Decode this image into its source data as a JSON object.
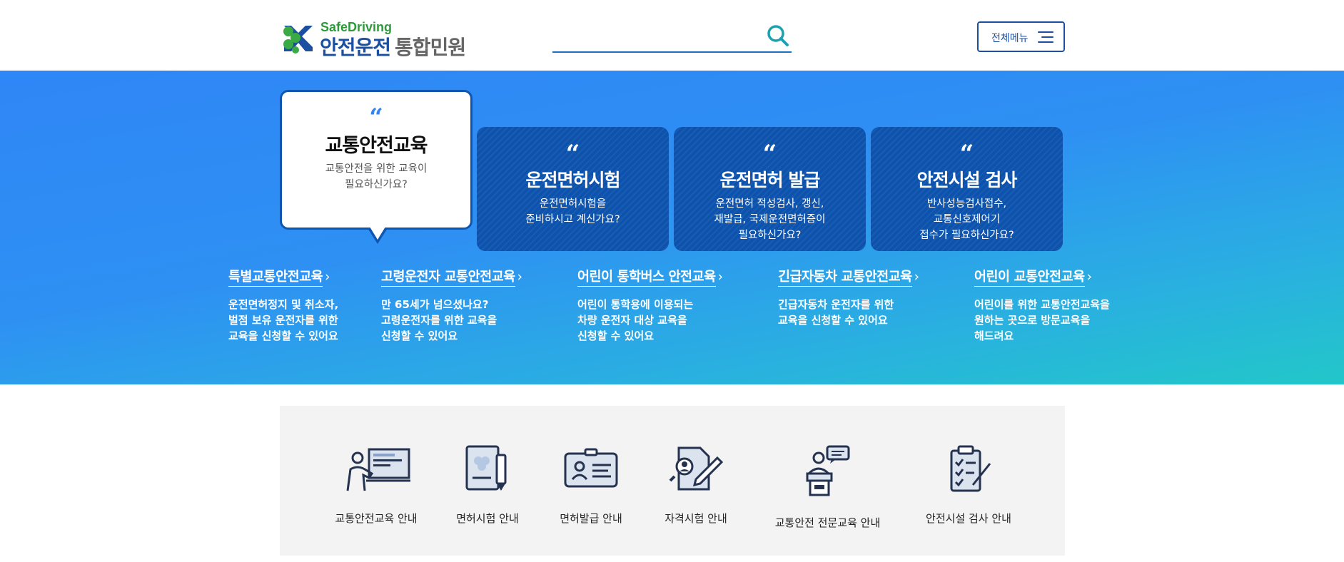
{
  "header": {
    "logo_sub": "SafeDriving",
    "logo_main": "안전운전",
    "logo_service": "통합민원",
    "search_placeholder": "",
    "menu_label": "전체메뉴"
  },
  "cards": [
    {
      "title": "교통안전교육",
      "desc": "교통안전을 위한 교육이\n필요하신가요?"
    },
    {
      "title": "운전면허시험",
      "desc": "운전면허시험을\n준비하시고 계신가요?"
    },
    {
      "title": "운전면허 발급",
      "desc": "운전면허 적성검사, 갱신,\n재발급, 국제운전면허증이\n필요하신가요?"
    },
    {
      "title": "안전시설 검사",
      "desc": "반사성능검사접수,\n교통신호제어기\n접수가 필요하신가요?"
    }
  ],
  "sub_links": [
    {
      "label": "특별교통안전교육",
      "desc": "운전면허정지 및 취소자,\n벌점 보유 운전자를 위한\n교육을 신청할 수 있어요"
    },
    {
      "label": "고령운전자 교통안전교육",
      "desc": "만 65세가 넘으셨나요?\n고령운전자를 위한 교육을\n신청할 수 있어요"
    },
    {
      "label": "어린이 통학버스 안전교육",
      "desc": "어린이 통학용에 이용되는\n차량 운전자 대상 교육을\n신청할 수 있어요"
    },
    {
      "label": "긴급자동차 교통안전교육",
      "desc": "긴급자동차 운전자를 위한\n교육을 신청할 수 있어요"
    },
    {
      "label": "어린이 교통안전교육",
      "desc": "어린이를 위한 교통안전교육을\n원하는 곳으로 방문교육을\n해드려요"
    }
  ],
  "quick_links": [
    {
      "label": "교통안전교육 안내",
      "icon": "teacher-board-icon"
    },
    {
      "label": "면허시험 안내",
      "icon": "exam-document-icon"
    },
    {
      "label": "면허발급 안내",
      "icon": "license-card-icon"
    },
    {
      "label": "자격시험 안내",
      "icon": "certificate-exam-icon"
    },
    {
      "label": "교통안전 전문교육 안내",
      "icon": "lecturer-podium-icon"
    },
    {
      "label": "안전시설 검사 안내",
      "icon": "checklist-clipboard-icon"
    }
  ],
  "colors": {
    "brand_blue": "#1d4fa1",
    "brand_green": "#2f9a3c",
    "hero_start": "#2f86f6",
    "hero_end": "#22c7c9",
    "card_blue": "#0d53ad"
  }
}
